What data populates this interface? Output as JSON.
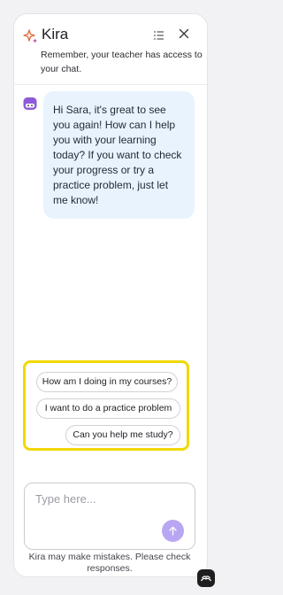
{
  "header": {
    "title": "Kira",
    "notice": "Remember, your teacher has access to your chat.",
    "icons": [
      "sparkle-icon",
      "list-icon",
      "close-icon"
    ]
  },
  "chat": {
    "message": "Hi Sara, it's great to see you again! How can I help you with your learning today? If you want to check your progress or try a practice problem, just let me know!"
  },
  "suggestions": [
    "How am I doing in my courses?",
    "I want to do a practice problem",
    "Can you help me study?"
  ],
  "input": {
    "placeholder": "Type here...",
    "value": ""
  },
  "disclaimer": "Kira may make mistakes. Please check responses.",
  "colors": {
    "bubble_bg": "#e8f3fd",
    "highlight_border": "#f2d800",
    "send_button": "#b9a6f2",
    "avatar": "#8e5ad9"
  }
}
